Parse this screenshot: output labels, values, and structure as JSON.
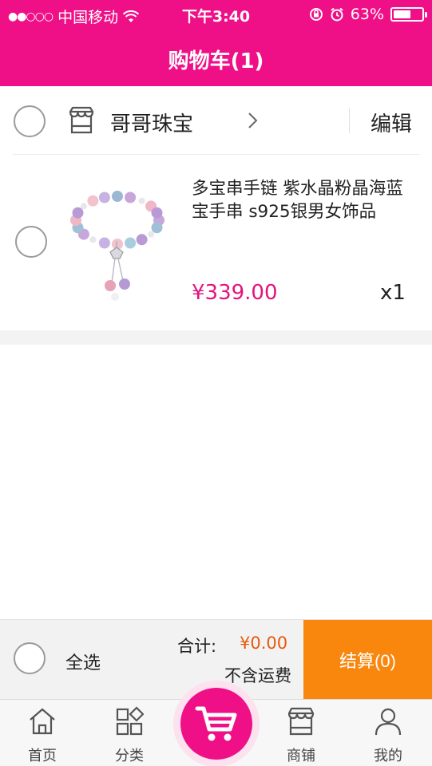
{
  "status_bar": {
    "carrier": "中国移动",
    "signal": "●●○○○",
    "time": "下午3:40",
    "battery": "63%",
    "battery_level": 0.63
  },
  "header": {
    "title": "购物车(1)"
  },
  "store": {
    "name": "哥哥珠宝",
    "edit_label": "编辑",
    "icon": "store-icon"
  },
  "cart_items": [
    {
      "name": "多宝串手链 紫水晶粉晶海蓝宝手串 s925银男女饰品",
      "price": "¥339.00",
      "quantity": "x1",
      "selected": false
    }
  ],
  "summary": {
    "select_all_label": "全选",
    "total_label": "合计:",
    "total_value": "¥0.00",
    "shipping_note": "不含运费",
    "checkout_label": "结算(0)"
  },
  "tabbar": {
    "items": [
      {
        "label": "首页",
        "icon": "home-icon"
      },
      {
        "label": "分类",
        "icon": "category-icon"
      },
      {
        "label": "",
        "icon": "cart-icon"
      },
      {
        "label": "商铺",
        "icon": "shop-icon"
      },
      {
        "label": "我的",
        "icon": "user-icon"
      }
    ]
  },
  "colors": {
    "brand": "#ef0f87",
    "price": "#e3137d",
    "total": "#e65a0f",
    "checkout": "#f9870e"
  }
}
